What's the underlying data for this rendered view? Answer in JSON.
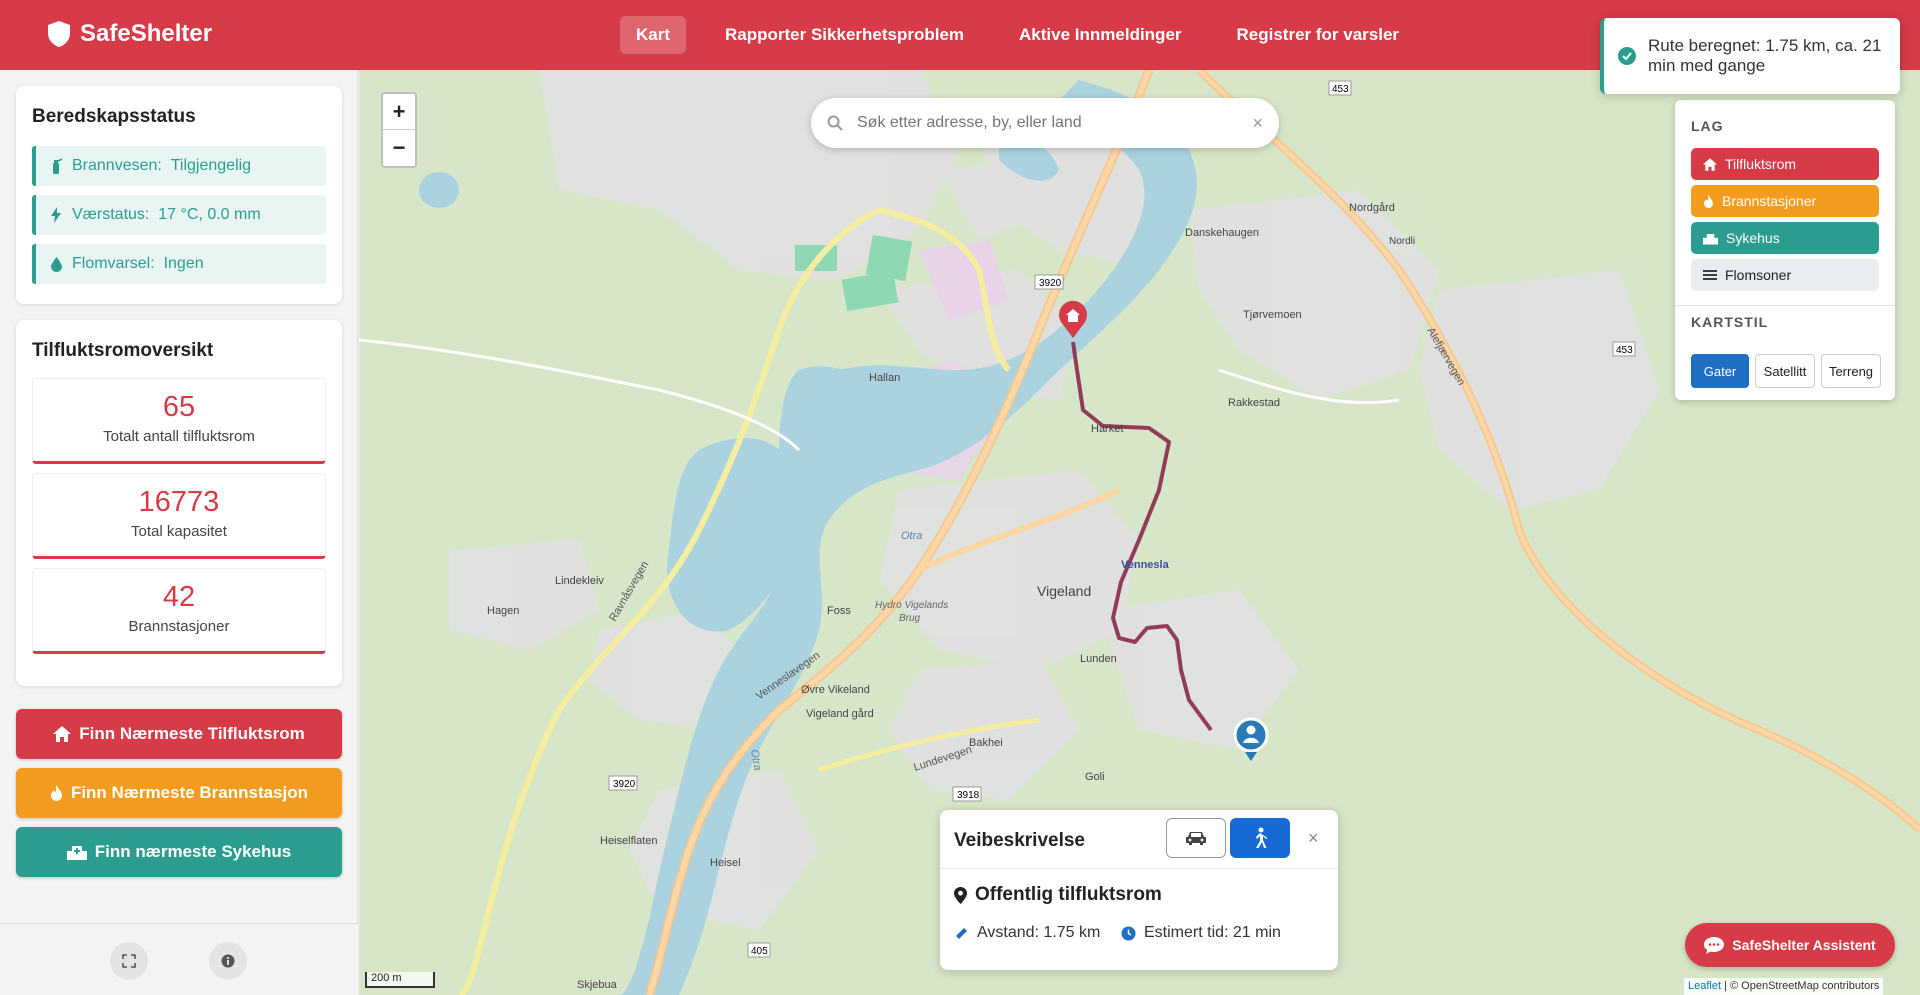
{
  "app": {
    "name": "SafeShelter",
    "brand_color": "#d63b47"
  },
  "nav": {
    "items": [
      {
        "label": "Kart",
        "active": true
      },
      {
        "label": "Rapporter Sikkerhetsproblem",
        "active": false
      },
      {
        "label": "Aktive Innmeldinger",
        "active": false
      },
      {
        "label": "Registrer for varsler",
        "active": false
      }
    ]
  },
  "preparedness": {
    "title": "Beredskapsstatus",
    "fire": {
      "label": "Brannvesen:",
      "value": "Tilgjengelig",
      "icon": "fire-extinguisher-icon"
    },
    "weather": {
      "label": "Værstatus:",
      "value": "17 °C, 0.0 mm",
      "icon": "bolt-icon"
    },
    "flood": {
      "label": "Flomvarsel:",
      "value": "Ingen",
      "icon": "droplet-icon"
    }
  },
  "overview": {
    "title": "Tilfluktsromoversikt",
    "stats": [
      {
        "value": "65",
        "label": "Totalt antall tilfluktsrom"
      },
      {
        "value": "16773",
        "label": "Total kapasitet"
      },
      {
        "value": "42",
        "label": "Brannstasjoner"
      }
    ]
  },
  "actions": {
    "shelter": {
      "label": "Finn Nærmeste Tilfluktsrom",
      "color": "#d63b47"
    },
    "fire_station": {
      "label": "Finn Nærmeste Brannstasjon",
      "color": "#f39c1f"
    },
    "hospital": {
      "label": "Finn nærmeste Sykehus",
      "color": "#2a9d8f"
    }
  },
  "footer": {
    "fullscreen_icon": "expand-icon",
    "info_icon": "info-icon"
  },
  "map": {
    "zoom_in": "+",
    "zoom_out": "−",
    "search": {
      "placeholder": "Søk etter adresse, by, eller land",
      "value": "",
      "clear": "×"
    },
    "layers": {
      "title": "LAG",
      "items": [
        {
          "label": "Tilfluktsrom",
          "color": "#d63b47"
        },
        {
          "label": "Brannstasjoner",
          "color": "#f39c1f"
        },
        {
          "label": "Sykehus",
          "color": "#2a9d8f"
        },
        {
          "label": "Flomsoner",
          "color": "#e9ecef"
        }
      ]
    },
    "map_style": {
      "title": "KARTSTIL",
      "options": [
        {
          "label": "Gater",
          "active": true
        },
        {
          "label": "Satellitt",
          "active": false
        },
        {
          "label": "Terreng",
          "active": false
        }
      ]
    },
    "labels": {
      "vigeland": "Vigeland",
      "vennesla": "Vennesla",
      "harket": "Harket",
      "rakkestad": "Rakkestad",
      "tjorvemoen": "Tjørvemoen",
      "danskehaugen": "Danskehaugen",
      "nordgard": "Nordgård",
      "hallan": "Hallan",
      "hagen": "Hagen",
      "lindekleiv": "Lindekleiv",
      "foss": "Foss",
      "ovre_vikeland": "Øvre Vikeland",
      "vigeland_gard": "Vigeland gård",
      "bakhei": "Bakhei",
      "goli": "Goli",
      "lunden": "Lunden",
      "heiselflaten": "Heiselflaten",
      "heisel": "Heisel",
      "skjebua": "Skjebua",
      "otra1": "Otra",
      "otra2": "Otra",
      "hydro": "Hydro Vigelands",
      "hydro2": "Brug",
      "nordli": "Nordli",
      "r3920a": "3920",
      "r3920b": "3920",
      "r3918": "3918",
      "r453a": "453",
      "r453b": "453",
      "r405": "405",
      "vennesla_vegen": "Venneslavegen",
      "ravnasvegen": "Ravnåsvegen",
      "lundevegen": "Lundevegen",
      "alefjaervegen": "Alefjærvegen"
    },
    "scale_label": "200 m",
    "attribution": {
      "leaflet": "Leaflet",
      "osm": "| © OpenStreetMap contributors"
    }
  },
  "toast": {
    "message": "Rute beregnet: 1.75 km, ca. 21 min med gange",
    "icon": "check-circle-icon"
  },
  "route": {
    "title": "Veibeskrivelse",
    "modes": [
      {
        "name": "car",
        "icon": "car-icon",
        "active": false
      },
      {
        "name": "walk",
        "icon": "walking-icon",
        "active": true
      }
    ],
    "close": "×",
    "destination": "Offentlig tilfluktsrom",
    "distance_label": "Avstand: 1.75 km",
    "time_label": "Estimert tid: 21 min",
    "route_color": "#8b2a4a"
  },
  "assistant": {
    "label": "SafeShelter Assistent"
  }
}
